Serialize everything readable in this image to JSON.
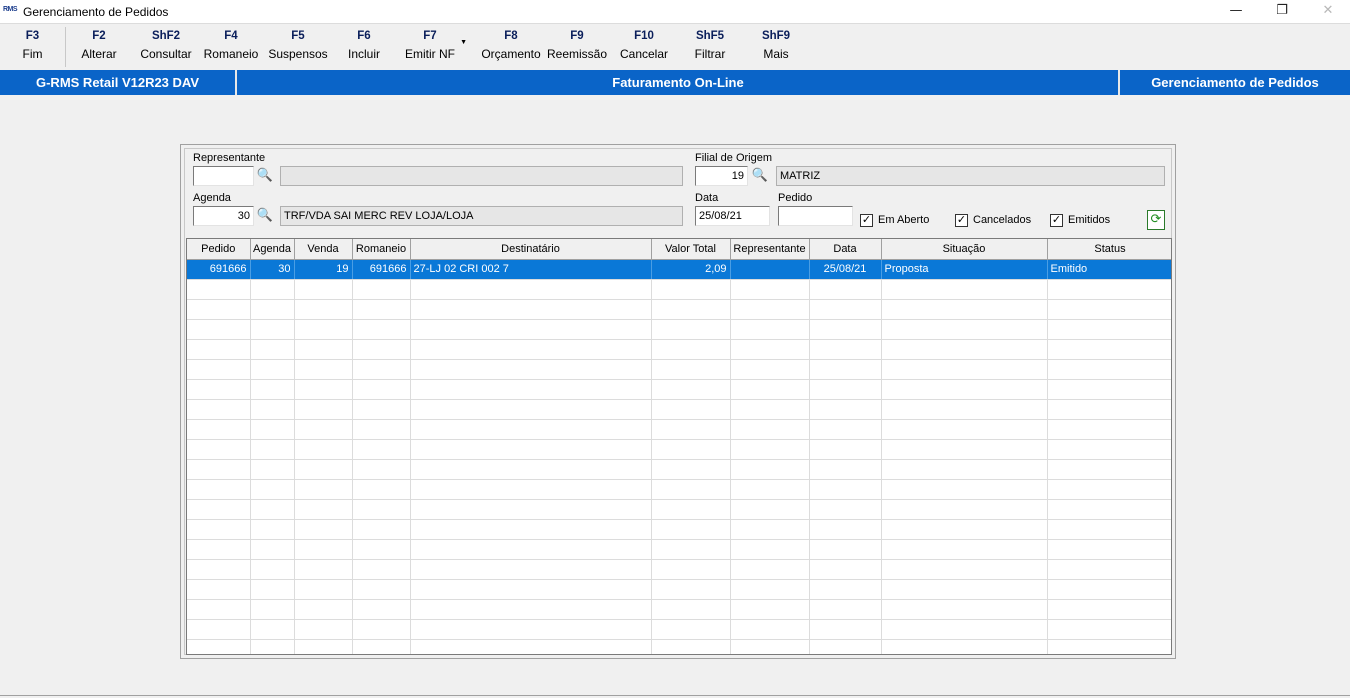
{
  "window": {
    "logo_text": "RMS",
    "title": "Gerenciamento de Pedidos",
    "minimize_glyph": "—",
    "maximize_glyph": "❐",
    "close_glyph": "✕"
  },
  "toolbar": [
    {
      "key": "F3",
      "label": "Fim"
    },
    {
      "key": "F2",
      "label": "Alterar"
    },
    {
      "key": "ShF2",
      "label": "Consultar"
    },
    {
      "key": "F4",
      "label": "Romaneio"
    },
    {
      "key": "F5",
      "label": "Suspensos"
    },
    {
      "key": "F6",
      "label": "Incluir"
    },
    {
      "key": "F7",
      "label": "Emitir NF"
    },
    {
      "key": "F8",
      "label": "Orçamento"
    },
    {
      "key": "F9",
      "label": "Reemissão"
    },
    {
      "key": "F10",
      "label": "Cancelar"
    },
    {
      "key": "ShF5",
      "label": "Filtrar"
    },
    {
      "key": "ShF9",
      "label": "Mais"
    }
  ],
  "statusbar": {
    "left": "G-RMS Retail V12R23 DAV",
    "center": "Faturamento On-Line",
    "right": "Gerenciamento de Pedidos"
  },
  "filters": {
    "representante_label": "Representante",
    "representante_code": "",
    "representante_name": "",
    "filial_label": "Filial de Origem",
    "filial_code": "19",
    "filial_name": "MATRIZ",
    "agenda_label": "Agenda",
    "agenda_code": "30",
    "agenda_name": "TRF/VDA SAI MERC REV LOJA/LOJA",
    "data_label": "Data",
    "data_value": "25/08/21",
    "pedido_label": "Pedido",
    "pedido_value": "",
    "em_aberto_label": "Em Aberto",
    "em_aberto_checked": true,
    "cancelados_label": "Cancelados",
    "cancelados_checked": true,
    "emitidos_label": "Emitidos",
    "emitidos_checked": true,
    "check_glyph": "✓",
    "lookup_glyph": "🔍",
    "refresh_glyph": "⟳"
  },
  "grid": {
    "columns": [
      "Pedido",
      "Agenda",
      "Venda",
      "Romaneio",
      "Destinatário",
      "Valor Total",
      "Representante",
      "Data",
      "Situação",
      "Status"
    ],
    "rows": [
      {
        "pedido": "691666",
        "agenda": "30",
        "venda": "19",
        "romaneio": "691666",
        "destinatario": "27-LJ 02   CRI   002 7",
        "valor_total": "2,09",
        "representante": "",
        "data": "25/08/21",
        "situacao": "Proposta",
        "status": "Emitido",
        "selected": true
      }
    ]
  }
}
